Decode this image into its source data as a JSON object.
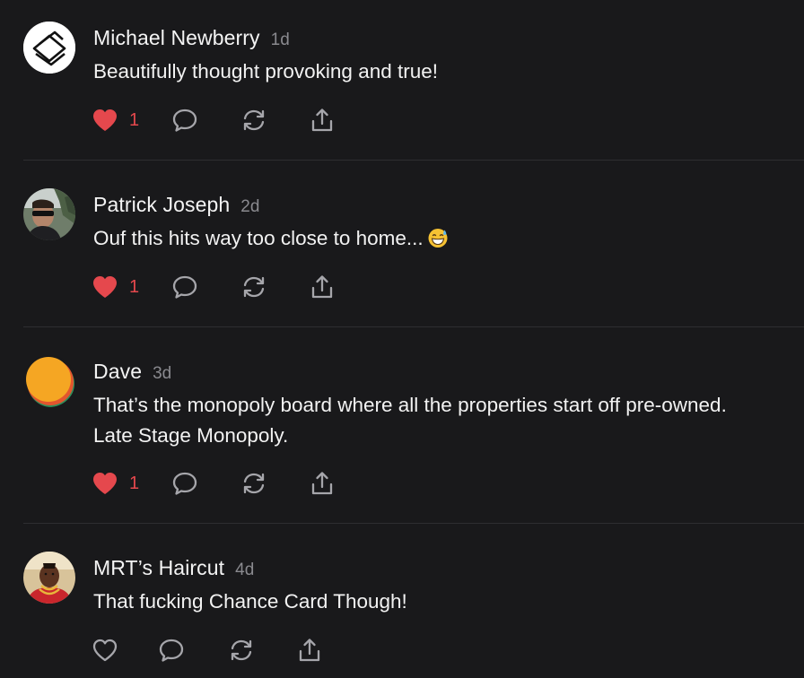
{
  "comments": [
    {
      "author": "Michael Newberry",
      "age": "1d",
      "lines": [
        "Beautifully thought provoking and true!"
      ],
      "likes": "1",
      "liked": true,
      "avatar": "outline-logo-avatar"
    },
    {
      "author": "Patrick Joseph",
      "age": "2d",
      "lines": [
        "Ouf this hits way too close to home..."
      ],
      "emoji": "grinning-sweat-emoji",
      "likes": "1",
      "liked": true,
      "avatar": "photo-avatar"
    },
    {
      "author": "Dave",
      "age": "3d",
      "lines": [
        "That’s the monopoly board where all the properties start off pre-owned.",
        "Late Stage Monopoly."
      ],
      "likes": "1",
      "liked": true,
      "avatar": "orange-disc-avatar"
    },
    {
      "author": "MRT’s Haircut",
      "age": "4d",
      "lines": [
        "That fucking Chance Card Though!"
      ],
      "likes": "",
      "liked": false,
      "avatar": "photo-avatar"
    }
  ],
  "colors": {
    "background": "#19191b",
    "text": "#f2f2f2",
    "muted": "#8a8a8f",
    "like": "#e5484d",
    "icon": "#a6a6ab",
    "divider": "#2e2e31"
  },
  "icons": {
    "like": "heart-icon",
    "reply": "speech-bubble-icon",
    "restack": "restack-arrows-icon",
    "share": "share-upload-icon"
  }
}
